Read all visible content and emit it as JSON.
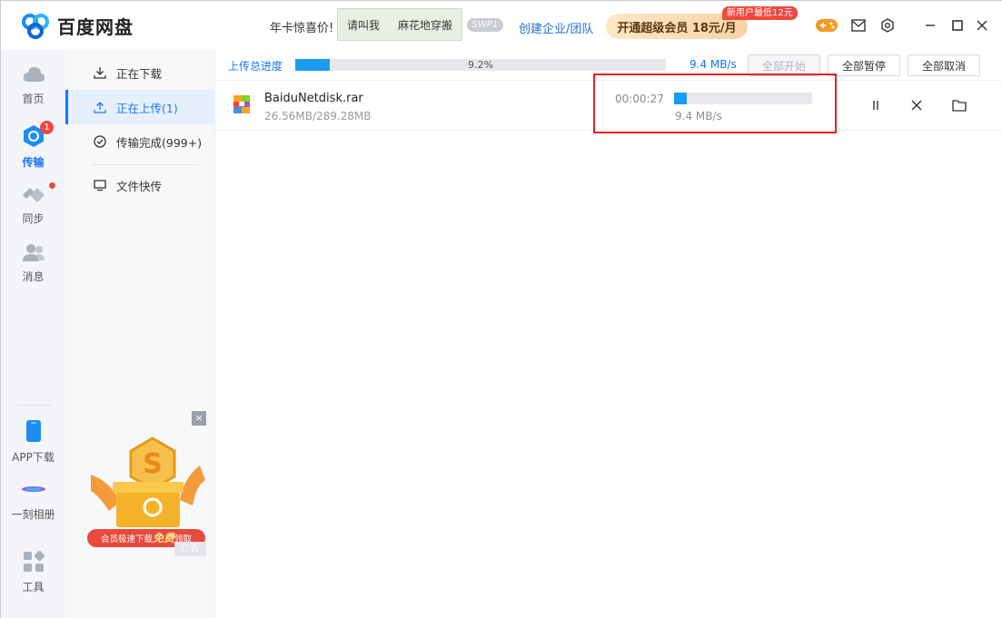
{
  "app": {
    "logo_text": "百度网盘"
  },
  "header": {
    "promo_text": "年卡惊喜价!",
    "banner_text_1": "请叫我",
    "banner_text_2": "麻花地穿搬",
    "swipe_label": "SWP1",
    "enterprise_link": "创建企业/团队",
    "vip_button": "开通超级会员 18元/月",
    "vip_tag": "新用户最低12元"
  },
  "leftnav": {
    "items": [
      {
        "label": "首页",
        "icon": "cloud-icon"
      },
      {
        "label": "传输",
        "icon": "transfer-icon",
        "badge": "1"
      },
      {
        "label": "同步",
        "icon": "sync-icon"
      },
      {
        "label": "消息",
        "icon": "message-icon"
      },
      {
        "label": "APP下载",
        "icon": "phone-icon"
      },
      {
        "label": "一刻相册",
        "icon": "album-icon"
      },
      {
        "label": "工具",
        "icon": "tools-icon"
      }
    ]
  },
  "subnav": {
    "items": [
      {
        "label": "正在下载",
        "icon": "download-icon"
      },
      {
        "label": "正在上传(1)",
        "icon": "upload-icon"
      },
      {
        "label": "传输完成(999+)",
        "icon": "check-circle-icon"
      },
      {
        "label": "文件快传",
        "icon": "monitor-icon"
      }
    ],
    "ad_caption_pre": "会员极速下载",
    "ad_caption_em": "免费",
    "ad_caption_post": "领取",
    "ad_label": "广告",
    "ad_close": "×"
  },
  "main": {
    "total_label": "上传总进度",
    "total_percent_text": "9.2%",
    "total_progress": 0.092,
    "total_speed": "9.4 MB/s",
    "btn_start_all": "全部开始",
    "btn_pause_all": "全部暂停",
    "btn_cancel_all": "全部取消",
    "file": {
      "name": "BaiduNetdisk.rar",
      "size": "26.56MB/289.28MB",
      "time": "00:00:27",
      "speed": "9.4 MB/s",
      "progress": 0.092
    }
  },
  "colors": {
    "accent": "#1677ff",
    "progress": "#1a9cf0",
    "highlight": "#e52420",
    "badge": "#f0483e"
  }
}
